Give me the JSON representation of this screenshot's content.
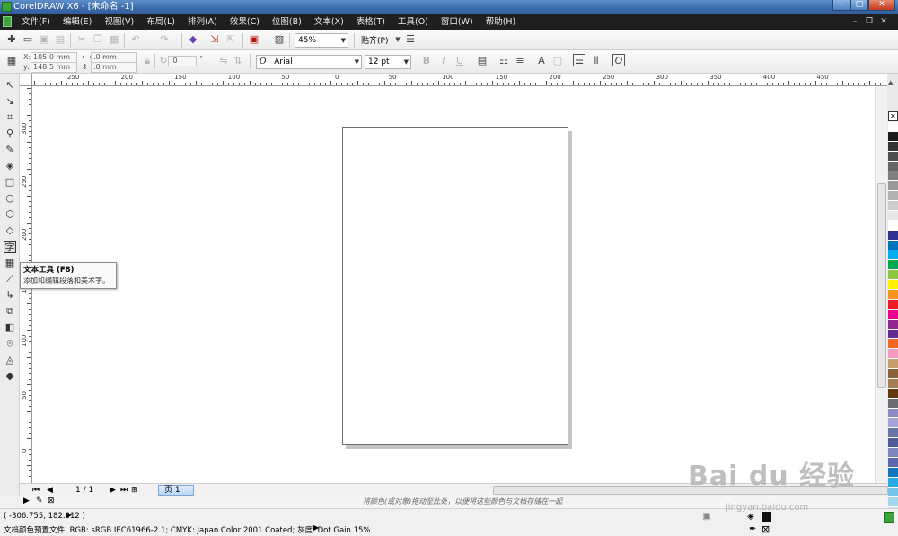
{
  "window": {
    "title": "CorelDRAW X6 - [未命名 -1]"
  },
  "menu": [
    "文件(F)",
    "编辑(E)",
    "视图(V)",
    "布局(L)",
    "排列(A)",
    "效果(C)",
    "位图(B)",
    "文本(X)",
    "表格(T)",
    "工具(O)",
    "窗口(W)",
    "帮助(H)"
  ],
  "toolbar": {
    "zoom": "45%",
    "snap": "贴齐(P)"
  },
  "property_bar": {
    "x_label": "X:",
    "x_value": "105.0 mm",
    "y_label": "y:",
    "y_value": "148.5 mm",
    "w_value": ".0 mm",
    "h_value": ".0 mm",
    "angle_value": ".0",
    "font_name": "Arial",
    "font_size": "12 pt"
  },
  "ruler": {
    "h_labels": [
      "250",
      "200",
      "150",
      "100",
      "50",
      "0",
      "50",
      "100",
      "150",
      "200",
      "250",
      "300",
      "350",
      "400",
      "450"
    ],
    "v_labels": [
      "300",
      "250",
      "200",
      "150",
      "100",
      "50",
      "0"
    ]
  },
  "tooltip": {
    "title": "文本工具 (F8)",
    "description": "添加和编辑段落和美术字。"
  },
  "pager": {
    "count": "1 / 1",
    "page_tab": "页 1"
  },
  "doc_palette_hint": "将颜色(或对象)拖动至此处，以便将这些颜色与文档存储在一起",
  "status": {
    "coords": "( -306.755, 182.012 )",
    "color_profile": "文档颜色预置文件: RGB: sRGB IEC61966-2.1; CMYK: Japan Color 2001 Coated; 灰度: Dot Gain 15%"
  },
  "palette_colors": [
    "#ffffff",
    "#1a1a1a",
    "#333333",
    "#4d4d4d",
    "#666666",
    "#808080",
    "#999999",
    "#b3b3b3",
    "#cccccc",
    "#e6e6e6",
    "#ffffff",
    "#2e3192",
    "#0072bc",
    "#00aeef",
    "#00a651",
    "#8dc63f",
    "#fff200",
    "#f7941d",
    "#ed1c24",
    "#ec008c",
    "#92278f",
    "#662d91",
    "#f26522",
    "#f49ac1",
    "#c69c6d",
    "#8c6239",
    "#a67c52",
    "#603913",
    "#6d6e71",
    "#8a8cc2",
    "#a3a5d6",
    "#6674a8",
    "#4d5b99",
    "#7c86bd",
    "#5a6aad",
    "#0f75bc",
    "#27aae1",
    "#74c6e8",
    "#a3d8ec",
    "#c7e5f1"
  ],
  "watermark": "Bai du 经验",
  "watermark_sub": "jingyan.baidu.com"
}
